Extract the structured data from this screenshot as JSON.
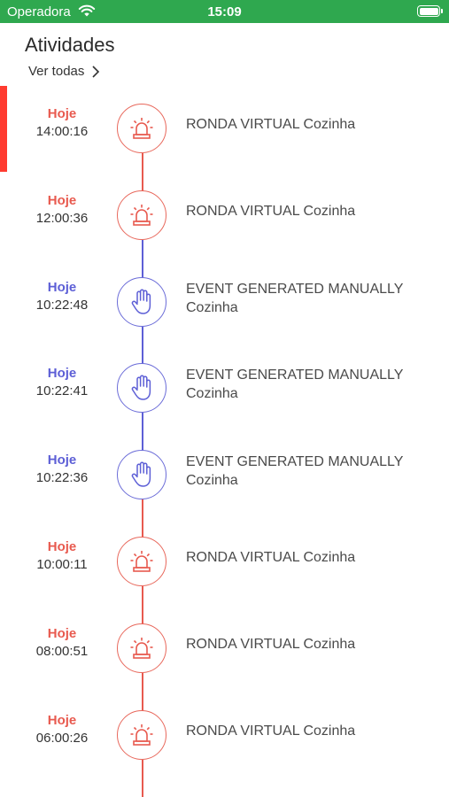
{
  "status_bar": {
    "carrier": "Operadora",
    "time": "15:09",
    "background_color": "#2fa84f"
  },
  "header": {
    "title": "Atividades",
    "view_all_label": "Ver todas",
    "view_all_icon": "chevron-right-icon"
  },
  "colors": {
    "alarm": "#e85a4f",
    "manual": "#5d5fd6",
    "active_marker": "#ff3b30"
  },
  "activities": [
    {
      "type": "alarm",
      "day": "Hoje",
      "time": "14:00:16",
      "description": "RONDA VIRTUAL Cozinha",
      "icon": "siren-icon"
    },
    {
      "type": "alarm",
      "day": "Hoje",
      "time": "12:00:36",
      "description": "RONDA VIRTUAL Cozinha",
      "icon": "siren-icon"
    },
    {
      "type": "manual",
      "day": "Hoje",
      "time": "10:22:48",
      "description": "EVENT GENERATED MANUALLY Cozinha",
      "icon": "hand-icon"
    },
    {
      "type": "manual",
      "day": "Hoje",
      "time": "10:22:41",
      "description": "EVENT GENERATED MANUALLY Cozinha",
      "icon": "hand-icon"
    },
    {
      "type": "manual",
      "day": "Hoje",
      "time": "10:22:36",
      "description": "EVENT GENERATED MANUALLY Cozinha",
      "icon": "hand-icon"
    },
    {
      "type": "alarm",
      "day": "Hoje",
      "time": "10:00:11",
      "description": "RONDA VIRTUAL Cozinha",
      "icon": "siren-icon"
    },
    {
      "type": "alarm",
      "day": "Hoje",
      "time": "08:00:51",
      "description": "RONDA VIRTUAL Cozinha",
      "icon": "siren-icon"
    },
    {
      "type": "alarm",
      "day": "Hoje",
      "time": "06:00:26",
      "description": "RONDA VIRTUAL Cozinha",
      "icon": "siren-icon"
    }
  ]
}
